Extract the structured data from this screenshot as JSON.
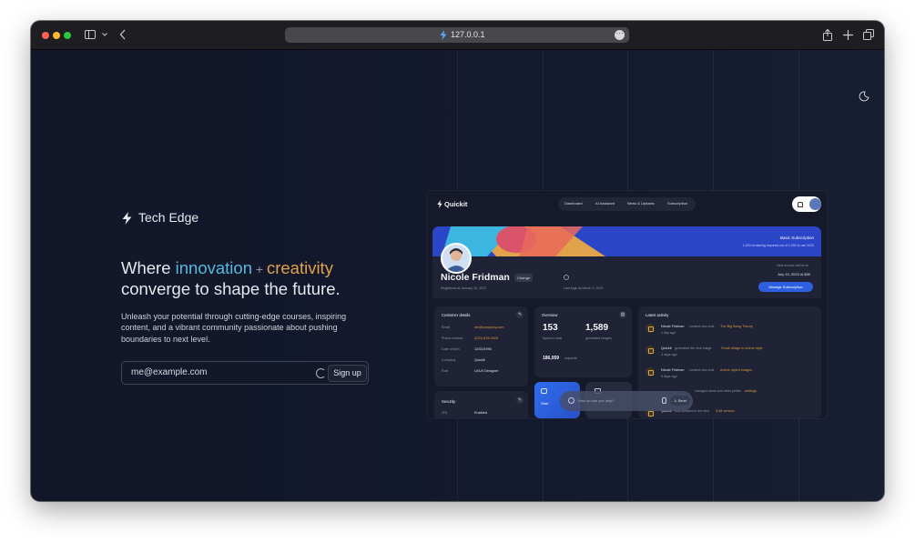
{
  "browser": {
    "url": "127.0.0.1",
    "traffic_lights": [
      "#ff5f57",
      "#febc2e",
      "#28c840"
    ]
  },
  "landing": {
    "brand": "Tech Edge",
    "headline": {
      "prefix": "Where ",
      "word1": "innovation",
      "plus": "+",
      "word2": "creativity",
      "rest": "converge to shape the future."
    },
    "description": "Unleash your potential through cutting-edge courses, inspiring content, and a vibrant community passionate about pushing boundaries to next level.",
    "email_value": "me@example.com",
    "signup_label": "Sign up",
    "colors": {
      "accent_cyan": "#57b9dd",
      "accent_orange": "#e0a24a"
    }
  },
  "dashboard": {
    "logo": "Quickit",
    "nav": [
      "Dashboard",
      "AI Assistant",
      "News & Updates",
      "Subscription"
    ],
    "banner": {
      "plan": "Basic Subscription",
      "remaining": "1,000 remaining requests out of 1,000 to use 2023"
    },
    "profile": {
      "name": "Nicole Fridman",
      "change": "Change",
      "registered": "Registered at January 10, 2022",
      "last_login": "Last login at March 3, 2023",
      "next_invoice_label": "Next invoice will be at",
      "next_invoice": "July 10, 2023 of $30",
      "manage": "Manage Subscription"
    },
    "customer": {
      "title": "Customer details",
      "rows": [
        {
          "k": "Email",
          "v": "me@company.com"
        },
        {
          "k": "Phone number",
          "v": "(220) 815-0926"
        },
        {
          "k": "Date of birth",
          "v": "12/02/1994"
        },
        {
          "k": "Company",
          "v": "Quickit"
        },
        {
          "k": "Role",
          "v": "UI/UX Designer"
        }
      ]
    },
    "security": {
      "title": "Security",
      "k": "2FA",
      "v": "Enabled"
    },
    "overview": {
      "title": "Overview",
      "topics": "153",
      "topics_label": "topics in chat",
      "images": "1,589",
      "images_label": "generated images",
      "requests": "186,059",
      "requests_label": "requests",
      "start_label": "Start"
    },
    "activity": {
      "title": "Latest activity",
      "items": [
        {
          "who": "Nicole Fridman",
          "what": "created new chat",
          "target": "The Big Bang Theory",
          "when": "1 day ago"
        },
        {
          "who": "Quickit",
          "what": "generated the new image",
          "target": "Small village in anime style",
          "when": "3 days ago"
        },
        {
          "who": "Nicole Fridman",
          "what": "created new chat",
          "target": "Anime styled images",
          "when": "5 days ago"
        },
        {
          "who": "",
          "what": "changed name and other profile",
          "target": "settings",
          "when": ""
        },
        {
          "who": "Quickit",
          "what": "was updated to the new",
          "target": "3.08 version",
          "when": ""
        }
      ]
    },
    "chat": {
      "placeholder": "How do can you help?",
      "send": "Send"
    }
  }
}
